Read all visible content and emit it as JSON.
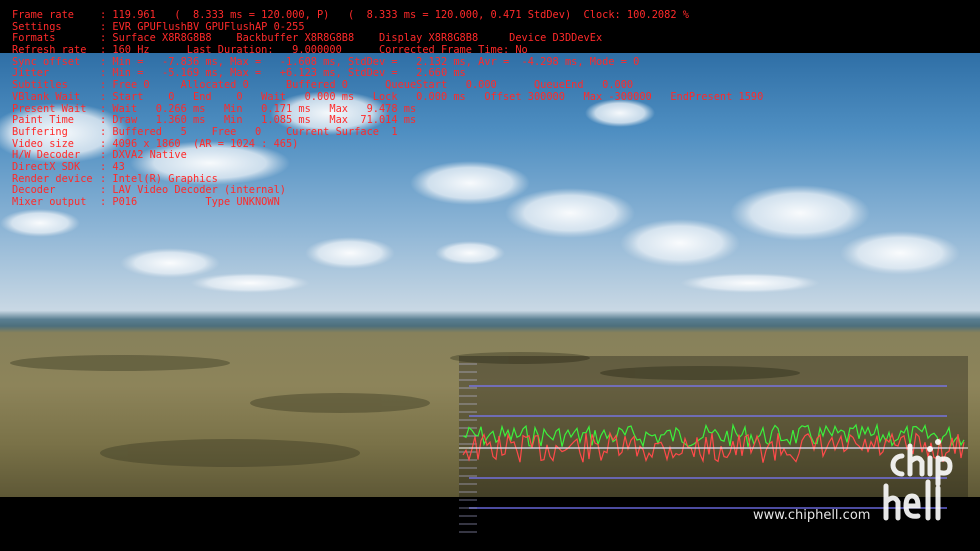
{
  "osd": {
    "rows": [
      {
        "key": "Frame rate",
        "value": ": 119.961   (  8.333 ms = 120.000, P)   (  8.333 ms = 120.000, 0.471 StdDev)  Clock: 100.2082 %"
      },
      {
        "key": "Settings",
        "value": ": EVR GPUFlushBV GPUFlushAP 0-255"
      },
      {
        "key": "Formats",
        "value": ": Surface X8R8G8B8    Backbuffer X8R8G8B8    Display X8R8G8B8     Device D3DDevEx"
      },
      {
        "key": "Refresh rate",
        "value": ": 160 Hz      Last Duration:   9.000000      Corrected Frame Time: No"
      },
      {
        "key": "Sync offset",
        "value": ": Min =   -7.836 ms, Max =   -1.608 ms, StdDev =   2.132 ms, Avr =  -4.298 ms, Mode = 0"
      },
      {
        "key": "Jitter",
        "value": ": Min =   -5.169 ms, Max =   +6.123 ms, StdDev =   2.660 ms"
      },
      {
        "key": "Subtitles",
        "value": ": Free 0     Allocated 0      Buffered 0      QueueStart   0.000      QueueEnd   0.000"
      },
      {
        "key": "VBlank Wait",
        "value": ": Start    0   End    0   Wait   0.000 ms   Lock   0.000 ms   Offset 300000   Max -300000   EndPresent 1590"
      },
      {
        "key": "Present Wait",
        "value": ": Wait   0.266 ms   Min   0.171 ms   Max   9.478 ms"
      },
      {
        "key": "Paint Time",
        "value": ": Draw   1.360 ms   Min   1.085 ms   Max  71.014 ms"
      },
      {
        "key": "Buffering",
        "value": ": Buffered   5    Free   0    Current Surface  1"
      },
      {
        "key": "Video size",
        "value": ": 4096 x 1860  (AR = 1024 : 465)"
      },
      {
        "key": "H/W Decoder",
        "value": ": DXVA2 Native"
      },
      {
        "key": "DirectX SDK",
        "value": ": 43"
      },
      {
        "key": "Render device",
        "value": ": Intel(R) Graphics"
      },
      {
        "key": "Decoder",
        "value": ": LAV Video Decoder (internal)"
      },
      {
        "key": "Mixer output",
        "value": ": P016           Type UNKNOWN"
      }
    ]
  },
  "graph": {
    "grid_color": "#7a78ff",
    "sync_color": "#3cf03c",
    "jitter_color": "#ff4a4a",
    "reference_color": "#ffffff"
  },
  "watermark": {
    "url": "www.chiphell.com",
    "logo_text": "chip hell"
  }
}
